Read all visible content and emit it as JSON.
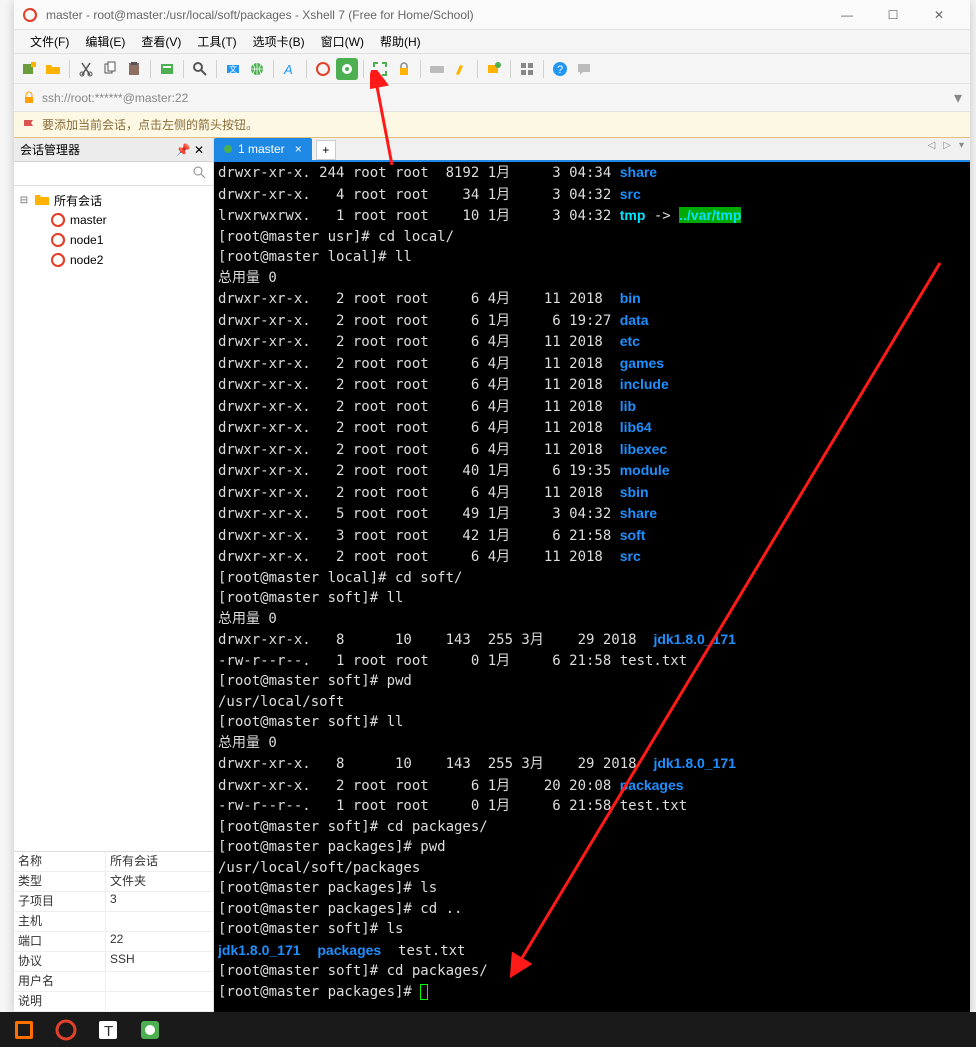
{
  "title": "master - root@master:/usr/local/soft/packages - Xshell 7 (Free for Home/School)",
  "menus": [
    "文件(F)",
    "编辑(E)",
    "查看(V)",
    "工具(T)",
    "选项卡(B)",
    "窗口(W)",
    "帮助(H)"
  ],
  "address": "ssh://root:******@master:22",
  "hint": "要添加当前会话，点击左侧的箭头按钮。",
  "sidebar_title": "会话管理器",
  "root_session": "所有会话",
  "sessions": [
    "master",
    "node1",
    "node2"
  ],
  "tab_label": "1 master",
  "props": [
    {
      "k": "名称",
      "v": "所有会话"
    },
    {
      "k": "类型",
      "v": "文件夹"
    },
    {
      "k": "子项目",
      "v": "3"
    },
    {
      "k": "主机",
      "v": ""
    },
    {
      "k": "端口",
      "v": "22"
    },
    {
      "k": "协议",
      "v": "SSH"
    },
    {
      "k": "用户名",
      "v": ""
    },
    {
      "k": "说明",
      "v": ""
    }
  ],
  "term": {
    "usr": [
      {
        "perm": "drwxr-xr-x.",
        "n": "244",
        "o": "root",
        "g": "root",
        "sz": "8192",
        "m": "1月",
        "d": "3",
        "t": "04:34",
        "name": "share",
        "dir": true
      },
      {
        "perm": "drwxr-xr-x.",
        "n": "4",
        "o": "root",
        "g": "root",
        "sz": "34",
        "m": "1月",
        "d": "3",
        "t": "04:32",
        "name": "src",
        "dir": true
      },
      {
        "perm": "lrwxrwxrwx.",
        "n": "1",
        "o": "root",
        "g": "root",
        "sz": "10",
        "m": "1月",
        "d": "3",
        "t": "04:32",
        "name": "tmp",
        "link": "../var/tmp"
      }
    ],
    "p1": "[root@master usr]# cd local/",
    "p2": "[root@master local]# ll",
    "total": "总用量 0",
    "local": [
      {
        "perm": "drwxr-xr-x.",
        "n": "2",
        "o": "root",
        "g": "root",
        "sz": "6",
        "m": "4月",
        "d": "11",
        "t": "2018",
        "name": "bin"
      },
      {
        "perm": "drwxr-xr-x.",
        "n": "2",
        "o": "root",
        "g": "root",
        "sz": "6",
        "m": "1月",
        "d": "6",
        "t": "19:27",
        "name": "data"
      },
      {
        "perm": "drwxr-xr-x.",
        "n": "2",
        "o": "root",
        "g": "root",
        "sz": "6",
        "m": "4月",
        "d": "11",
        "t": "2018",
        "name": "etc"
      },
      {
        "perm": "drwxr-xr-x.",
        "n": "2",
        "o": "root",
        "g": "root",
        "sz": "6",
        "m": "4月",
        "d": "11",
        "t": "2018",
        "name": "games"
      },
      {
        "perm": "drwxr-xr-x.",
        "n": "2",
        "o": "root",
        "g": "root",
        "sz": "6",
        "m": "4月",
        "d": "11",
        "t": "2018",
        "name": "include"
      },
      {
        "perm": "drwxr-xr-x.",
        "n": "2",
        "o": "root",
        "g": "root",
        "sz": "6",
        "m": "4月",
        "d": "11",
        "t": "2018",
        "name": "lib"
      },
      {
        "perm": "drwxr-xr-x.",
        "n": "2",
        "o": "root",
        "g": "root",
        "sz": "6",
        "m": "4月",
        "d": "11",
        "t": "2018",
        "name": "lib64"
      },
      {
        "perm": "drwxr-xr-x.",
        "n": "2",
        "o": "root",
        "g": "root",
        "sz": "6",
        "m": "4月",
        "d": "11",
        "t": "2018",
        "name": "libexec"
      },
      {
        "perm": "drwxr-xr-x.",
        "n": "2",
        "o": "root",
        "g": "root",
        "sz": "40",
        "m": "1月",
        "d": "6",
        "t": "19:35",
        "name": "module"
      },
      {
        "perm": "drwxr-xr-x.",
        "n": "2",
        "o": "root",
        "g": "root",
        "sz": "6",
        "m": "4月",
        "d": "11",
        "t": "2018",
        "name": "sbin"
      },
      {
        "perm": "drwxr-xr-x.",
        "n": "5",
        "o": "root",
        "g": "root",
        "sz": "49",
        "m": "1月",
        "d": "3",
        "t": "04:32",
        "name": "share"
      },
      {
        "perm": "drwxr-xr-x.",
        "n": "3",
        "o": "root",
        "g": "root",
        "sz": "42",
        "m": "1月",
        "d": "6",
        "t": "21:58",
        "name": "soft"
      },
      {
        "perm": "drwxr-xr-x.",
        "n": "2",
        "o": "root",
        "g": "root",
        "sz": "6",
        "m": "4月",
        "d": "11",
        "t": "2018",
        "name": "src"
      }
    ],
    "p3": "[root@master local]# cd soft/",
    "p4": "[root@master soft]# ll",
    "soft1": [
      {
        "perm": "drwxr-xr-x.",
        "n": "8",
        "o": "",
        "g": "10",
        "sz": "143",
        "sz2": "255",
        "m": "3月",
        "d": "29",
        "t": "2018",
        "name": "jdk1.8.0_171",
        "dir": true
      },
      {
        "perm": "-rw-r--r--.",
        "n": "1",
        "o": "root",
        "g": "root",
        "sz": "0",
        "m": "1月",
        "d": "6",
        "t": "21:58",
        "name": "test.txt",
        "dir": false
      }
    ],
    "p5": "[root@master soft]# pwd",
    "pwd1": "/usr/local/soft",
    "p6": "[root@master soft]# ll",
    "soft2": [
      {
        "perm": "drwxr-xr-x.",
        "n": "8",
        "o": "",
        "g": "10",
        "sz": "143",
        "sz2": "255",
        "m": "3月",
        "d": "29",
        "t": "2018",
        "name": "jdk1.8.0_171",
        "dir": true
      },
      {
        "perm": "drwxr-xr-x.",
        "n": "2",
        "o": "root",
        "g": "root",
        "sz": "6",
        "m": "1月",
        "d": "20",
        "t": "20:08",
        "name": "packages",
        "dir": true
      },
      {
        "perm": "-rw-r--r--.",
        "n": "1",
        "o": "root",
        "g": "root",
        "sz": "0",
        "m": "1月",
        "d": "6",
        "t": "21:58",
        "name": "test.txt",
        "dir": false
      }
    ],
    "p7": "[root@master soft]# cd packages/",
    "p8": "[root@master packages]# pwd",
    "pwd2": "/usr/local/soft/packages",
    "p9": "[root@master packages]# ls",
    "p10": "[root@master packages]# cd ..",
    "p11": "[root@master soft]# ls",
    "ls_items": [
      {
        "t": "jdk1.8.0_171",
        "c": "b-blue"
      },
      {
        "t": "  "
      },
      {
        "t": "packages",
        "c": "b-blue"
      },
      {
        "t": "  test.txt"
      }
    ],
    "p12": "[root@master soft]# cd packages/",
    "p13": "[root@master packages]# "
  }
}
